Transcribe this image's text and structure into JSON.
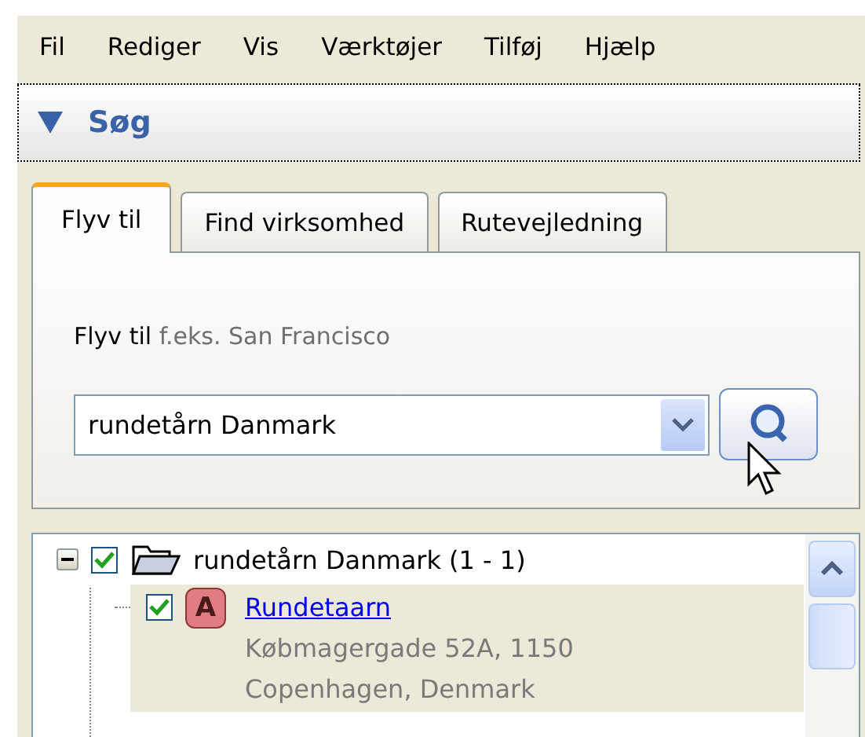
{
  "menu": [
    {
      "label": "Fil"
    },
    {
      "label": "Rediger"
    },
    {
      "label": "Vis"
    },
    {
      "label": "Værktøjer"
    },
    {
      "label": "Tilføj"
    },
    {
      "label": "Hjælp"
    }
  ],
  "panel": {
    "title": "Søg",
    "expanded": true
  },
  "tabs": [
    {
      "label": "Flyv til",
      "selected": true
    },
    {
      "label": "Find virksomhed",
      "selected": false
    },
    {
      "label": "Rutevejledning",
      "selected": false
    }
  ],
  "fly_to": {
    "label": "Flyv til",
    "hint": "f.eks. San Francisco",
    "value": "rundetårn Danmark"
  },
  "results": {
    "label": "rundetårn Danmark (1 - 1)",
    "checked": true,
    "expanded": true,
    "children": [
      {
        "title": "Rundetaarn",
        "marker": "A",
        "address_lines": [
          "Købmagergade 52A, 1150",
          "Copenhagen, Denmark"
        ],
        "checked": true,
        "selected": true
      }
    ]
  }
}
